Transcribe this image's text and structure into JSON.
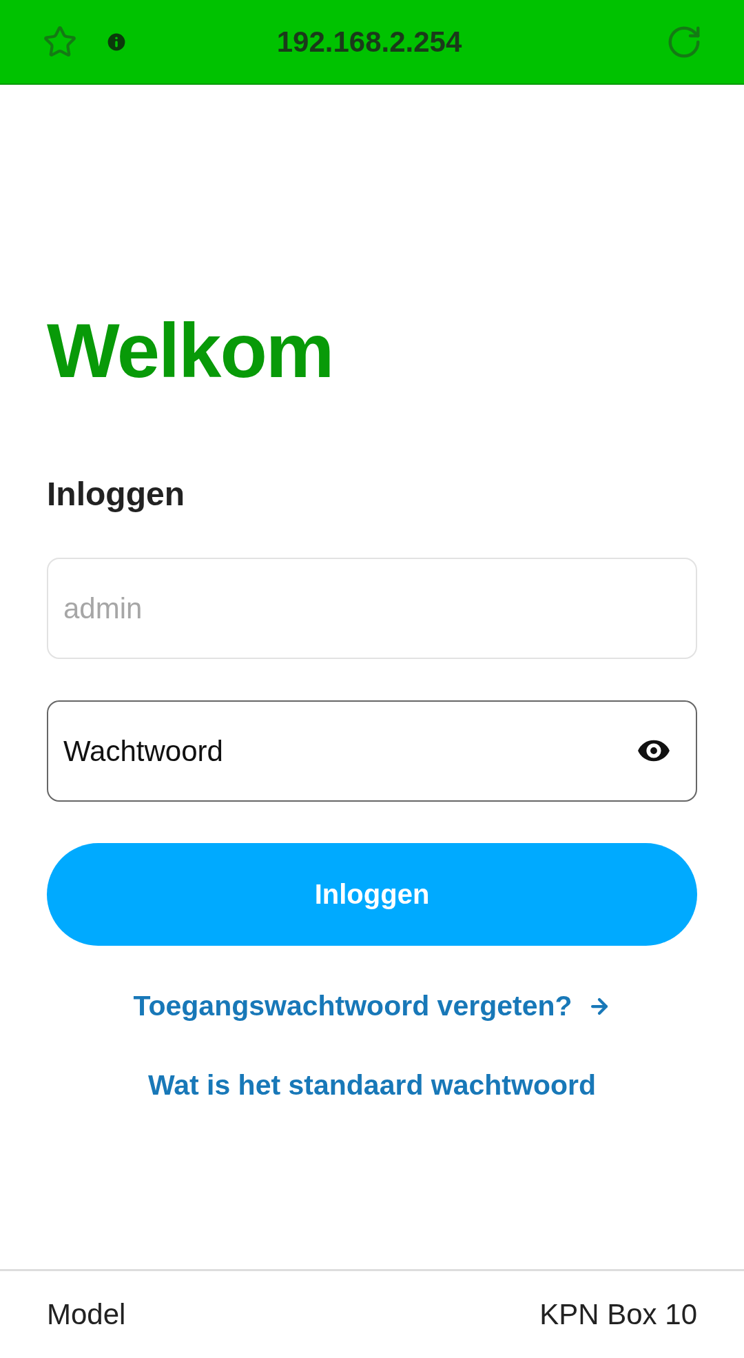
{
  "address_bar": {
    "url": "192.168.2.254"
  },
  "heading": "Welkom",
  "form": {
    "title": "Inloggen",
    "fields": [
      {
        "placeholder": "admin",
        "focused": false,
        "password": false
      },
      {
        "placeholder": "Wachtwoord",
        "focused": true,
        "password": true
      }
    ],
    "submit": "Inloggen"
  },
  "links": [
    {
      "label": "Toegangswachtwoord vergeten?",
      "arrow": true
    },
    {
      "label": "Wat is het standaard wachtwoord",
      "arrow": false
    }
  ],
  "footer": {
    "label": "Model",
    "value": "KPN Box 10"
  }
}
